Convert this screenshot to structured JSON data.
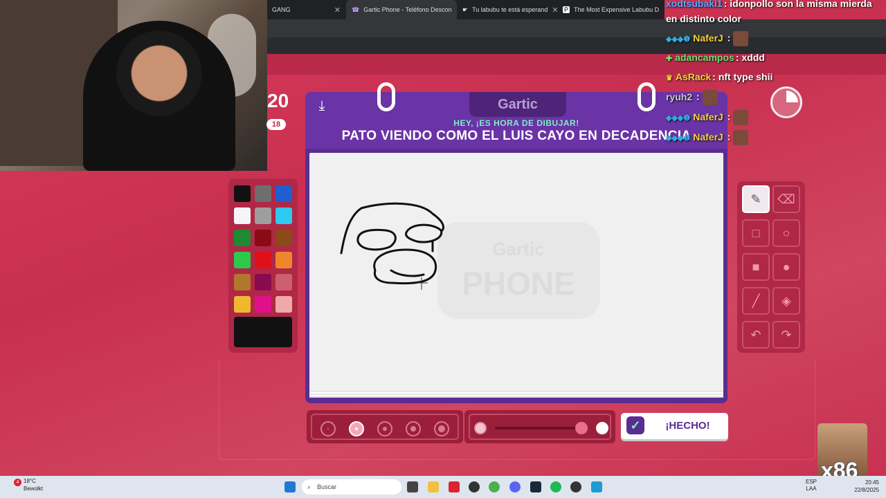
{
  "browser": {
    "tabs": [
      {
        "label": "GANG",
        "active": false
      },
      {
        "label": "Gartic Phone - Teléfono Descon",
        "active": true
      },
      {
        "label": "Tu labubu te está esperand",
        "active": false
      },
      {
        "label": "The Most Expensive Labubu D",
        "active": false
      }
    ]
  },
  "game": {
    "score": "20",
    "score_badge": "18",
    "logo": "Gartic",
    "subtitle": "HEY, ¡ES HORA DE DIBUJAR!",
    "prompt": "PATO VIENDO COMO EL LUIS CAYO EN DECADENCIA",
    "done_label": "¡HECHO!",
    "watermark": "Gartic PHONE"
  },
  "palette": {
    "colors": [
      "#111111",
      "#6e6e6e",
      "#1f5fd1",
      "#f5f5f5",
      "#9e9e9e",
      "#2fc8ee",
      "#1e8a32",
      "#8c0a14",
      "#8b4a18",
      "#2ec84a",
      "#e0101a",
      "#f0862c",
      "#b0782a",
      "#8a0a50",
      "#cc6070",
      "#f0b830",
      "#e0108a",
      "#f0a8a8"
    ],
    "current": "#111111"
  },
  "tools": [
    {
      "name": "pencil",
      "icon": "✎",
      "active": true
    },
    {
      "name": "eraser",
      "icon": "⌫",
      "active": false
    },
    {
      "name": "rectangle-outline",
      "icon": "□",
      "active": false
    },
    {
      "name": "circle-outline",
      "icon": "○",
      "active": false
    },
    {
      "name": "rectangle-filled",
      "icon": "■",
      "active": false
    },
    {
      "name": "circle-filled",
      "icon": "●",
      "active": false
    },
    {
      "name": "line",
      "icon": "╱",
      "active": false
    },
    {
      "name": "fill-bucket",
      "icon": "◈",
      "active": false
    },
    {
      "name": "undo",
      "icon": "↶",
      "active": false
    },
    {
      "name": "redo",
      "icon": "↷",
      "active": false
    }
  ],
  "brush": {
    "selected_size_index": 1,
    "opacity": 0.96
  },
  "chat": [
    {
      "user": "xodtsubaki1",
      "text": "idonpollo son la misma mierda",
      "color": "#5aa8ff"
    },
    {
      "user": "",
      "text": "en distinto color",
      "color": "#ffffff"
    },
    {
      "user": "NaferJ",
      "text": "",
      "color": "#f5d23c",
      "badges": "◆◆◆❶"
    },
    {
      "user": "adancampos",
      "text": "xddd",
      "color": "#6ee06e",
      "badges": "✚"
    },
    {
      "user": "AsRack",
      "text": "nft type shii",
      "color": "#f5d23c",
      "badges": "♛"
    },
    {
      "user": "ryuh2",
      "text": "",
      "color": "#c8c8c8"
    },
    {
      "user": "NaferJ",
      "text": "",
      "color": "#f5d23c",
      "badges": "◆◆◆❶"
    },
    {
      "user": "NaferJ",
      "text": "",
      "color": "#f5d23c",
      "badges": "◆◆◆❶"
    }
  ],
  "overlay": {
    "sticker_text": "x86"
  },
  "taskbar": {
    "weather_temp": "18°C",
    "weather_desc": "Bewolkt",
    "notification_count": "4",
    "search_placeholder": "Buscar",
    "lang_top": "ESP",
    "lang_bottom": "LAA",
    "time": "20:45",
    "date": "22/8/2025"
  }
}
